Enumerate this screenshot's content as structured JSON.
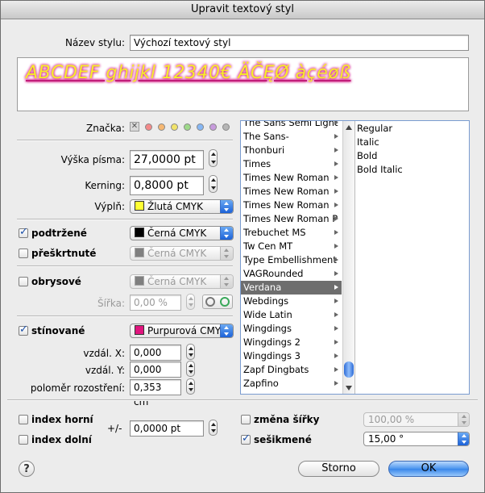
{
  "window": {
    "title": "Upravit textový styl"
  },
  "style_name": {
    "label": "Název stylu:",
    "value": "Výchozí textový styl"
  },
  "preview": {
    "text": "ABCDEF ghijkl 12340€ ÄČĘØ àçéøß"
  },
  "tags": {
    "label": "Značka:",
    "colors": [
      "#f48a8a",
      "#f6b873",
      "#f1e36a",
      "#9ed98a",
      "#86b7f4",
      "#c79bdc",
      "#b6b6b6"
    ]
  },
  "font_size": {
    "label": "Výška písma:",
    "value": "27,0000 pt"
  },
  "kerning": {
    "label": "Kerning:",
    "value": "0,8000 pt"
  },
  "fill": {
    "label": "Výplň:",
    "value": "Žlutá CMYK",
    "color": "#ffff33"
  },
  "underline": {
    "label": "podtržené",
    "checked": true,
    "color_value": "Černá CMYK",
    "color": "#000000"
  },
  "strikethrough": {
    "label": "přeškrtnuté",
    "checked": false,
    "color_value": "Černá CMYK",
    "color": "#808080"
  },
  "outline": {
    "label": "obrysové",
    "checked": false,
    "color_value": "Černá CMYK",
    "color": "#808080",
    "width_label": "Šířka:",
    "width_value": "0,00 %"
  },
  "shadow": {
    "label": "stínované",
    "checked": true,
    "color_value": "Purpurová CMY",
    "color": "#e0157e",
    "dist_x_label": "vzdál. X:",
    "dist_x_value": "0,000 cm",
    "dist_y_label": "vzdál. Y:",
    "dist_y_value": "0,000 cm",
    "blur_label": "poloměr rozostření:",
    "blur_value": "0,353 cm"
  },
  "fonts": {
    "families": [
      "The Sans Semi Light",
      "The Sans-",
      "Thonburi",
      "Times",
      "Times New Roman",
      "Times New Roman",
      "Times New Roman",
      "Times New Roman P",
      "Trebuchet MS",
      "Tw Cen MT",
      "Type Embellishment",
      "VAGRounded",
      "Verdana",
      "Webdings",
      "Wide Latin",
      "Wingdings",
      "Wingdings 2",
      "Wingdings 3",
      "Zapf Dingbats",
      "Zapfino"
    ],
    "selected_family": "Verdana",
    "styles": [
      "Regular",
      "Italic",
      "Bold",
      "Bold Italic"
    ]
  },
  "superscript": {
    "label": "index horní",
    "checked": false
  },
  "subscript": {
    "label": "index dolní",
    "checked": false
  },
  "offset": {
    "label": "+/-",
    "value": "0,0000 pt"
  },
  "width_change": {
    "label": "změna šířky",
    "checked": false,
    "value": "100,00 %"
  },
  "slant": {
    "label": "sešikmené",
    "checked": true,
    "value": "15,00 °"
  },
  "buttons": {
    "help": "?",
    "cancel": "Storno",
    "ok": "OK"
  }
}
